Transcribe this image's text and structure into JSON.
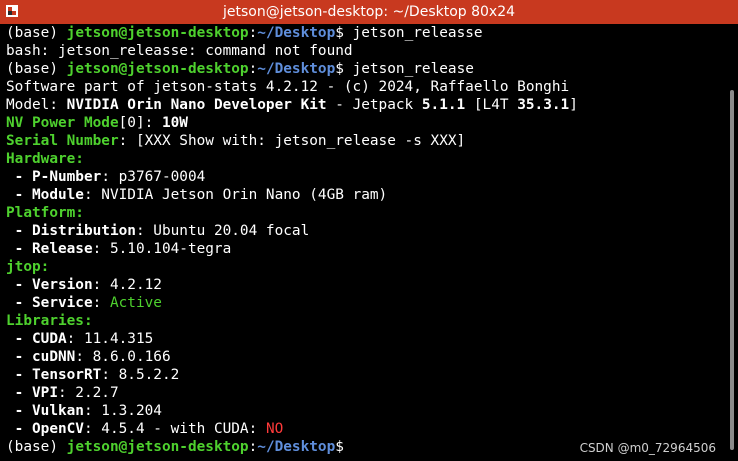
{
  "window": {
    "title": "jetson@jetson-desktop: ~/Desktop 80x24"
  },
  "prompt": {
    "env": "(base) ",
    "userhost": "jetson@jetson-desktop",
    "sep": ":",
    "path": "~/Desktop",
    "sigil": "$"
  },
  "lines": {
    "cmd1": " jetson_releasse",
    "err1": "bash: jetson_releasse: command not found",
    "cmd2": " jetson_release",
    "software": "Software part of jetson-stats 4.2.12 - (c) 2024, Raffaello Bonghi",
    "model_key": "Model: ",
    "model_val": "NVIDIA Orin Nano Developer Kit",
    "model_mid": " - Jetpack ",
    "jetpack": "5.1.1",
    "l4t_open": " [L4T ",
    "l4t": "35.3.1",
    "l4t_close": "]",
    "nvpm_key": "NV Power Mode",
    "nvpm_idx": "[0]",
    "nvpm_sep": ": ",
    "nvpm_val": "10W",
    "serial_key": "Serial Number",
    "serial_val": ": [XXX Show with: jetson_release -s XXX]",
    "hardware": "Hardware:",
    "pnum_key": " - P-Number",
    "pnum_val": ": p3767-0004",
    "module_key": " - Module",
    "module_val": ": NVIDIA Jetson Orin Nano (4GB ram)",
    "platform": "Platform:",
    "dist_key": " - Distribution",
    "dist_val": ": Ubuntu 20.04 focal",
    "rel_key": " - Release",
    "rel_val": ": 5.10.104-tegra",
    "jtop": "jtop:",
    "ver_key": " - Version",
    "ver_val": ": 4.2.12",
    "svc_key": " - Service",
    "svc_sep": ": ",
    "svc_val": "Active",
    "libraries": "Libraries:",
    "cuda_key": " - CUDA",
    "cuda_val": ": 11.4.315",
    "cudnn_key": " - cuDNN",
    "cudnn_val": ": 8.6.0.166",
    "trt_key": " - TensorRT",
    "trt_val": ": 8.5.2.2",
    "vpi_key": " - VPI",
    "vpi_val": ": 2.2.7",
    "vulkan_key": " - Vulkan",
    "vulkan_val": ": 1.3.204",
    "cv_key": " - OpenCV",
    "cv_val": ": 4.5.4 - with CUDA: ",
    "cv_cuda": "NO"
  },
  "watermark": "CSDN @m0_72964506"
}
